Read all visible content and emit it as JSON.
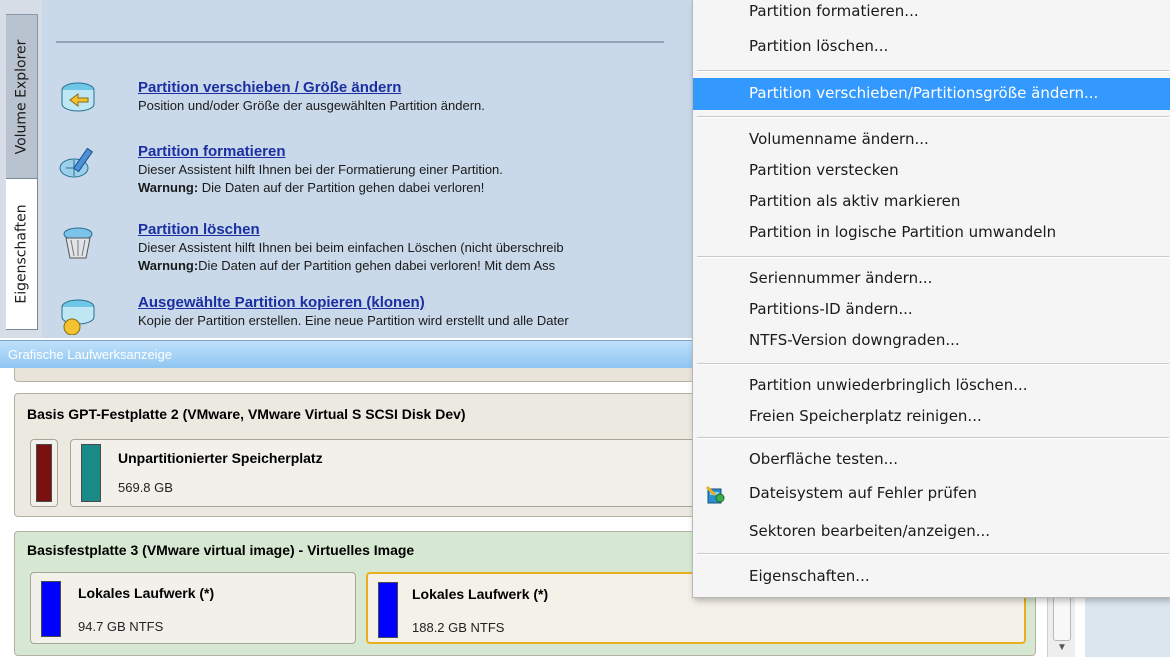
{
  "tabs": {
    "volume_explorer": "Volume Explorer",
    "eigenschaften": "Eigenschaften"
  },
  "wizards": [
    {
      "icon": "move-resize-partition-icon",
      "title": "Partition verschieben / Größe ändern",
      "desc": "Position und/oder Größe der ausgewählten Partition ändern.",
      "warn_label": "",
      "warn": ""
    },
    {
      "icon": "format-partition-icon",
      "title": "Partition formatieren",
      "desc": "Dieser Assistent hilft Ihnen bei der Formatierung einer Partition.",
      "warn_label": "Warnung:",
      "warn": " Die Daten auf der Partition gehen dabei verloren!"
    },
    {
      "icon": "delete-partition-icon",
      "title": "Partition löschen",
      "desc": "Dieser Assistent hilft Ihnen bei beim einfachen Löschen (nicht überschreib",
      "warn_label": "Warnung:",
      "warn": "Die Daten auf der Partition gehen dabei verloren! Mit dem Ass"
    },
    {
      "icon": "copy-partition-icon",
      "title": "Ausgewählte Partition kopieren (klonen)",
      "desc": "Kopie der Partition erstellen. Eine neue Partition wird erstellt und alle Dater",
      "warn_label": "",
      "warn": ""
    }
  ],
  "drive_view": {
    "header": "Grafische Laufwerksanzeige",
    "disks": [
      {
        "title": "Basis GPT-Festplatte 2 (VMware, VMware Virtual S SCSI Disk Dev)",
        "partitions": [
          {
            "label": "",
            "size": "",
            "color": "#7a1010"
          },
          {
            "label": "Unpartitionierter Speicherplatz",
            "size": "569.8 GB",
            "color": "#1a8a86"
          }
        ]
      },
      {
        "title": "Basisfestplatte 3 (VMware virtual image) - Virtuelles Image",
        "partitions": [
          {
            "label": "Lokales Laufwerk (*)",
            "size": "94.7 GB NTFS",
            "color": "#0000ff"
          },
          {
            "label": "Lokales Laufwerk (*)",
            "size": "188.2 GB NTFS",
            "color": "#0000ff",
            "selected": true
          }
        ]
      }
    ]
  },
  "context_menu": {
    "items": [
      "Partition formatieren...",
      "Partition löschen...",
      "Partition verschieben/Partitionsgröße ändern...",
      "Volumenname ändern...",
      "Partition verstecken",
      "Partition als aktiv markieren",
      "Partition in logische Partition umwandeln",
      "Seriennummer ändern...",
      "Partitions-ID ändern...",
      "NTFS-Version downgraden...",
      "Partition unwiederbringlich löschen...",
      "Freien Speicherplatz reinigen...",
      "Oberfläche testen...",
      "Dateisystem auf Fehler prüfen",
      "Sektoren bearbeiten/anzeigen...",
      "Eigenschaften..."
    ],
    "selected_index": 2,
    "check_icon": "filesystem-check-icon"
  },
  "colors": {
    "accent": "#3399ff",
    "link": "#1b2fa3",
    "wizard_bg": "#c9d9ea"
  }
}
